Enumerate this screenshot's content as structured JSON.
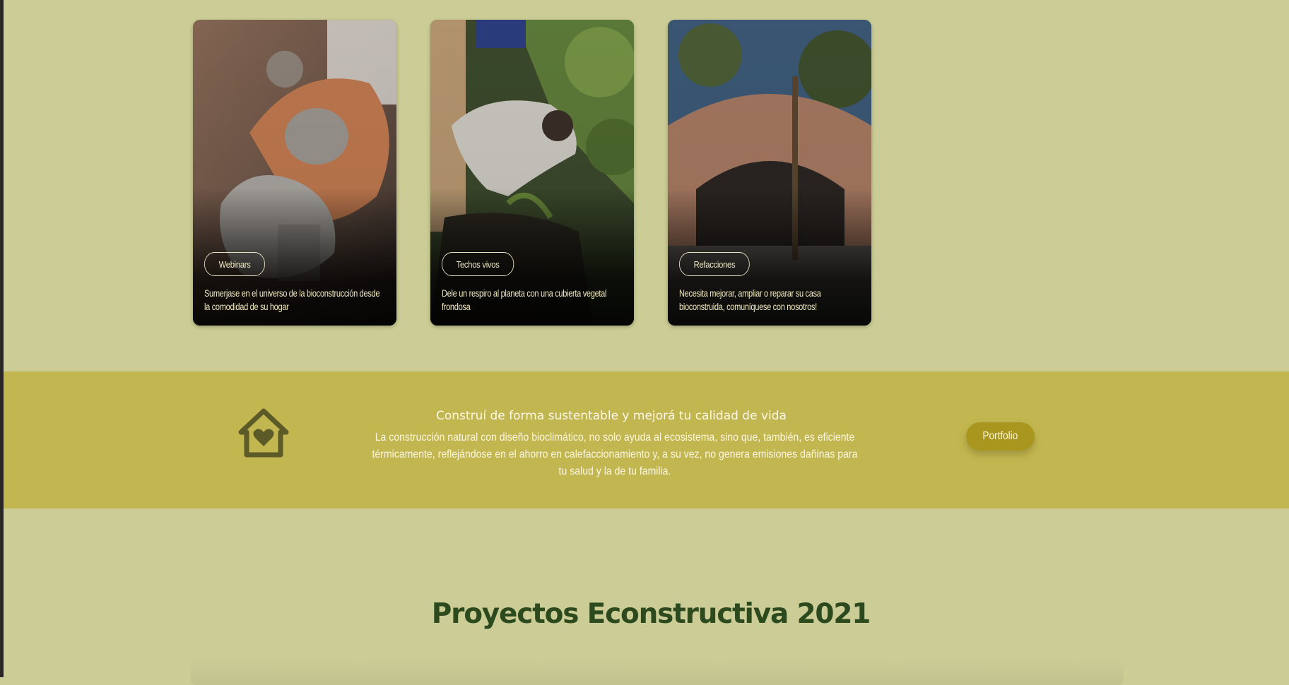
{
  "cards": [
    {
      "tag": "Webinars",
      "description": "Sumerjase en el universo de la bioconstrucción desde la comodidad de su hogar"
    },
    {
      "tag": "Techos vivos",
      "description": "Dele un respiro al planeta con una cubierta vegetal frondosa"
    },
    {
      "tag": "Refacciones",
      "description": "Necesita mejorar, ampliar o reparar su casa bioconstruida, comuníquese con nosotros!"
    }
  ],
  "cta": {
    "title": "Construí de forma sustentable y mejorá tu calidad de vida",
    "text": "La construcción natural con diseño bioclimático, no solo ayuda al ecosistema, sino que, también, es eficiente térmicamente, reflejándose en el ahorro en calefaccionamiento y, a su vez, no genera emisiones dañinas para tu salud y la de tu familia.",
    "button_label": "Portfolio",
    "icon": "house-heart-icon"
  },
  "projects": {
    "title": "Proyectos Econstructiva 2021"
  },
  "colors": {
    "page_bg": "#cccd96",
    "band_bg": "#c2b650",
    "button_bg": "#a9961e",
    "heading": "#2c4a1e",
    "icon": "#5a5a25"
  }
}
